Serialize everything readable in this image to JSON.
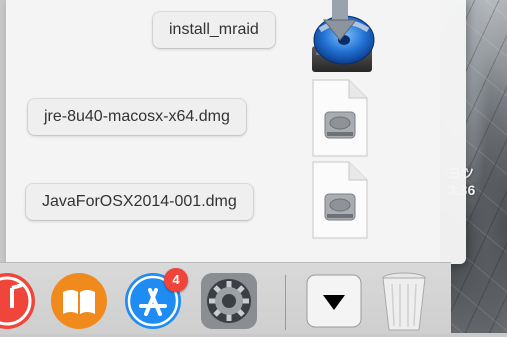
{
  "stack": {
    "items": [
      {
        "label": "install_mraid",
        "icon": "installer-package-icon"
      },
      {
        "label": "jre-8u40-macosx-x64.dmg",
        "icon": "disk-image-icon"
      },
      {
        "label": "JavaForOSX2014-001.dmg",
        "icon": "disk-image-icon"
      }
    ]
  },
  "dock": {
    "items": [
      {
        "name": "itunes-icon"
      },
      {
        "name": "ibooks-icon"
      },
      {
        "name": "app-store-icon",
        "badge": "4"
      },
      {
        "name": "system-preferences-icon"
      },
      {
        "name": "downloads-stack-icon"
      },
      {
        "name": "trash-icon"
      }
    ]
  },
  "desktop": {
    "clock_line1": "ヨツ",
    "clock_line2": "3.36"
  },
  "colors": {
    "app_store_blue": "#1e8cf2",
    "ibooks_orange": "#f08a1c",
    "itunes_red": "#f0453a",
    "badge_red": "#f0433a"
  }
}
